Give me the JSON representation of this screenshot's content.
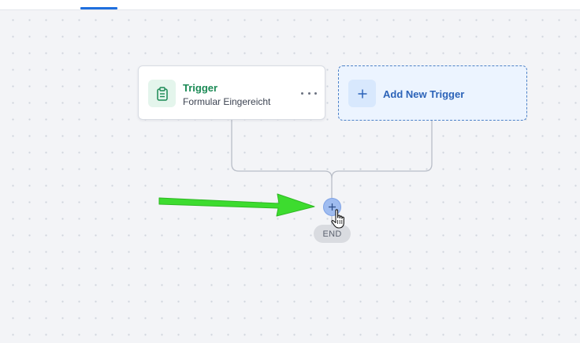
{
  "trigger_node": {
    "title": "Trigger",
    "subtitle": "Formular Eingereicht",
    "icon": "clipboard-icon",
    "more_icon": "more-horizontal-icon"
  },
  "add_trigger_node": {
    "label": "Add New Trigger",
    "icon": "plus-icon"
  },
  "add_step": {
    "icon": "plus-icon"
  },
  "end_node": {
    "label": "END"
  },
  "colors": {
    "canvas_bg": "#f3f4f7",
    "trigger_title": "#1b8a55",
    "add_trigger_text": "#2c63b8",
    "add_trigger_bg": "#ecf4ff",
    "annotation_arrow": "#3ddc2f",
    "active_tab": "#1f6fde"
  }
}
